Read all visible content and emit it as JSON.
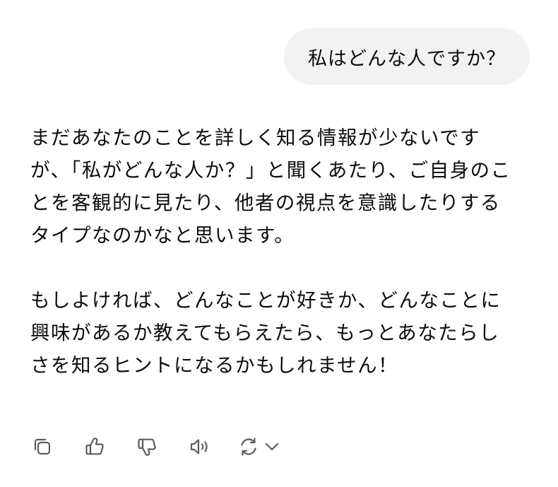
{
  "user_message": {
    "text": "私はどんな人ですか？"
  },
  "assistant_message": {
    "paragraphs": [
      "まだあなたのことを詳しく知る情報が少ないですが、「私がどんな人か？」と聞くあたり、ご自身のことを客観的に見たり、他者の視点を意識したりするタイプなのかなと思います。",
      "もしよければ、どんなことが好きか、どんなことに興味があるか教えてもらえたら、もっとあなたらしさを知るヒントになるかもしれません！"
    ]
  },
  "actions": [
    {
      "icon": "copy-icon"
    },
    {
      "icon": "thumbs-up-icon"
    },
    {
      "icon": "thumbs-down-icon"
    },
    {
      "icon": "read-aloud-icon"
    },
    {
      "icon": "regenerate-icon"
    },
    {
      "icon": "chevron-down-icon"
    }
  ],
  "colors": {
    "user_bubble_bg": "#f2f2f2",
    "text": "#0d0d0d",
    "icon": "#5d5d5d"
  }
}
